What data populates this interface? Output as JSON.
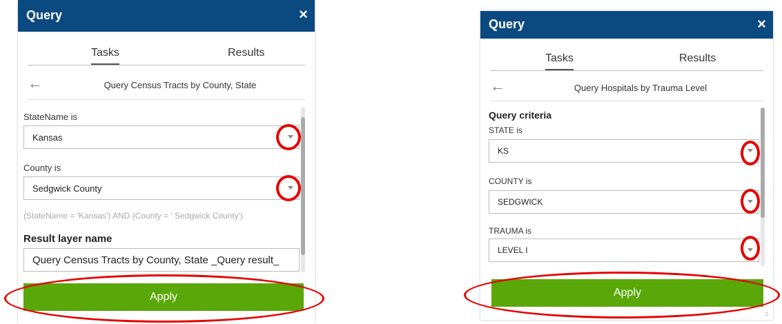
{
  "panel_left": {
    "title": "Query",
    "close": "×",
    "tabs": [
      "Tasks",
      "Results"
    ],
    "back": "←",
    "header": "Query Census Tracts by County, State",
    "field1_label": "StateName is",
    "field1_value": "Kansas",
    "field2_label": "County is",
    "field2_value": "Sedgwick County",
    "expression": "(StateName = 'Kansas') AND (County = ' Sedgwick County')",
    "result_label": "Result layer name",
    "result_value": "Query Census Tracts by County, State _Query result_",
    "apply": "Apply"
  },
  "panel_right": {
    "title": "Query",
    "close": "×",
    "tabs": [
      "Tasks",
      "Results"
    ],
    "back": "←",
    "header": "Query Hospitals by Trauma Level",
    "criteria_label": "Query criteria",
    "field1_label": "STATE is",
    "field1_value": "KS",
    "field2_label": "COUNTY is",
    "field2_value": "SEDGWICK",
    "field3_label": "TRAUMA is",
    "field3_value": "LEVEL I",
    "apply": "Apply"
  },
  "colors": {
    "titlebar": "#0b4a80",
    "apply": "#5aa70a",
    "annotation": "#e60000"
  }
}
